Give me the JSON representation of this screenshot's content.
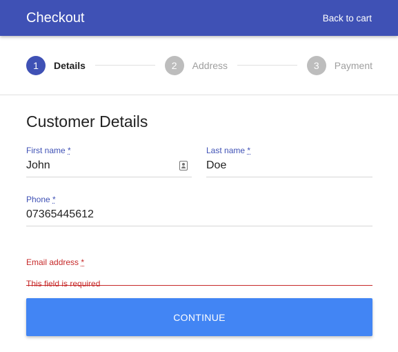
{
  "header": {
    "title": "Checkout",
    "back_link": "Back to cart"
  },
  "stepper": {
    "steps": [
      {
        "number": "1",
        "label": "Details",
        "state": "active"
      },
      {
        "number": "2",
        "label": "Address",
        "state": "inactive"
      },
      {
        "number": "3",
        "label": "Payment",
        "state": "inactive"
      }
    ]
  },
  "form": {
    "title": "Customer Details",
    "required_marker": "*",
    "fields": {
      "first_name": {
        "label": "First name",
        "value": "John",
        "icon": "contact-card-icon"
      },
      "last_name": {
        "label": "Last name",
        "value": "Doe"
      },
      "phone": {
        "label": "Phone",
        "value": "07365445612"
      },
      "email": {
        "label": "Email address",
        "value": "",
        "error": "This field is required"
      }
    },
    "submit_label": "CONTINUE"
  },
  "colors": {
    "primary": "#3f51b5",
    "button": "#4285f4",
    "error": "#c62828"
  }
}
